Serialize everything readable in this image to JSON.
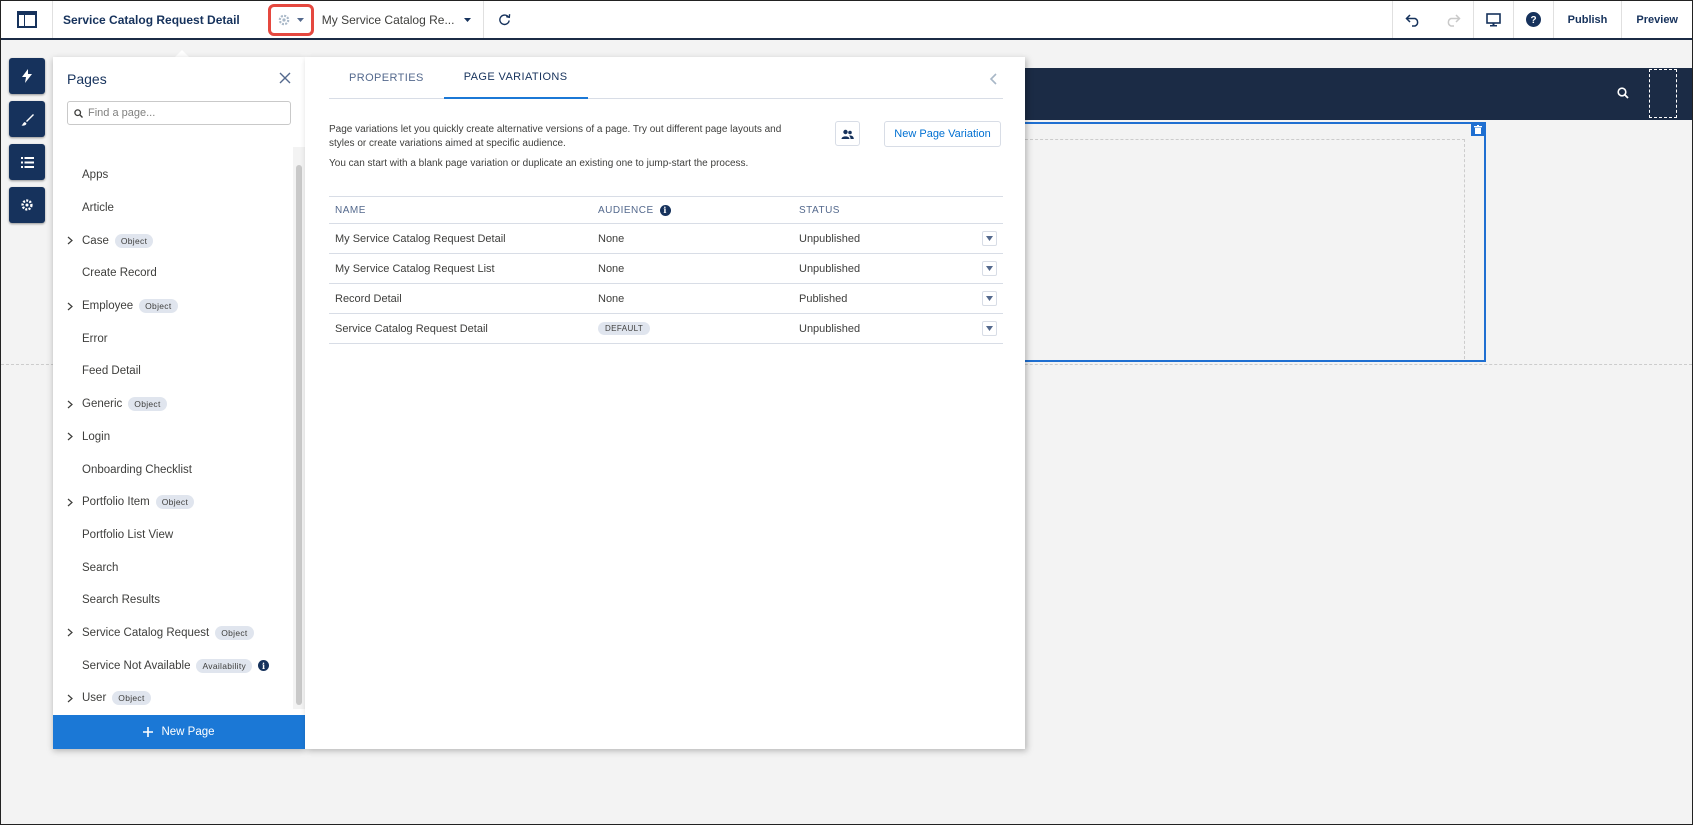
{
  "topbar": {
    "title": "Service Catalog Request Detail",
    "variation_label": "My Service Catalog Re...",
    "publish": "Publish",
    "preview": "Preview"
  },
  "pages_panel": {
    "title": "Pages",
    "search_placeholder": "Find a page...",
    "items": [
      {
        "label": "Apps",
        "badge": "",
        "expandable": false
      },
      {
        "label": "Article",
        "badge": "",
        "expandable": false
      },
      {
        "label": "Case",
        "badge": "Object",
        "expandable": true
      },
      {
        "label": "Create Record",
        "badge": "",
        "expandable": false
      },
      {
        "label": "Employee",
        "badge": "Object",
        "expandable": true
      },
      {
        "label": "Error",
        "badge": "",
        "expandable": false
      },
      {
        "label": "Feed Detail",
        "badge": "",
        "expandable": false
      },
      {
        "label": "Generic",
        "badge": "Object",
        "expandable": true
      },
      {
        "label": "Login",
        "badge": "",
        "expandable": true
      },
      {
        "label": "Onboarding Checklist",
        "badge": "",
        "expandable": false
      },
      {
        "label": "Portfolio Item",
        "badge": "Object",
        "expandable": true
      },
      {
        "label": "Portfolio List View",
        "badge": "",
        "expandable": false
      },
      {
        "label": "Search",
        "badge": "",
        "expandable": false
      },
      {
        "label": "Search Results",
        "badge": "",
        "expandable": false
      },
      {
        "label": "Service Catalog Request",
        "badge": "Object",
        "expandable": true
      },
      {
        "label": "Service Not Available",
        "badge": "Availability",
        "expandable": false,
        "info": true
      },
      {
        "label": "User",
        "badge": "Object",
        "expandable": true
      }
    ],
    "new_page": "New Page"
  },
  "props_panel": {
    "tabs": [
      {
        "label": "PROPERTIES",
        "active": false
      },
      {
        "label": "PAGE VARIATIONS",
        "active": true
      }
    ],
    "description": "Page variations let you quickly create alternative versions of a page. Try out different page layouts and styles or create variations aimed at specific audience.",
    "description2": "You can start with a blank page variation or duplicate an existing one to jump-start the process.",
    "new_variation_button": "New Page Variation",
    "table": {
      "headers": {
        "name": "NAME",
        "audience": "AUDIENCE",
        "status": "STATUS"
      },
      "rows": [
        {
          "name": "My Service Catalog Request Detail",
          "audience": "None",
          "status": "Unpublished",
          "default": false
        },
        {
          "name": "My Service Catalog Request List",
          "audience": "None",
          "status": "Unpublished",
          "default": false
        },
        {
          "name": "Record Detail",
          "audience": "None",
          "status": "Published",
          "default": false
        },
        {
          "name": "Service Catalog Request Detail",
          "audience": "DEFAULT",
          "status": "Unpublished",
          "default": true
        }
      ]
    }
  },
  "colors": {
    "brand_navy": "#16325c",
    "accent_blue": "#1b78d6",
    "highlight_red": "#e5483f"
  }
}
